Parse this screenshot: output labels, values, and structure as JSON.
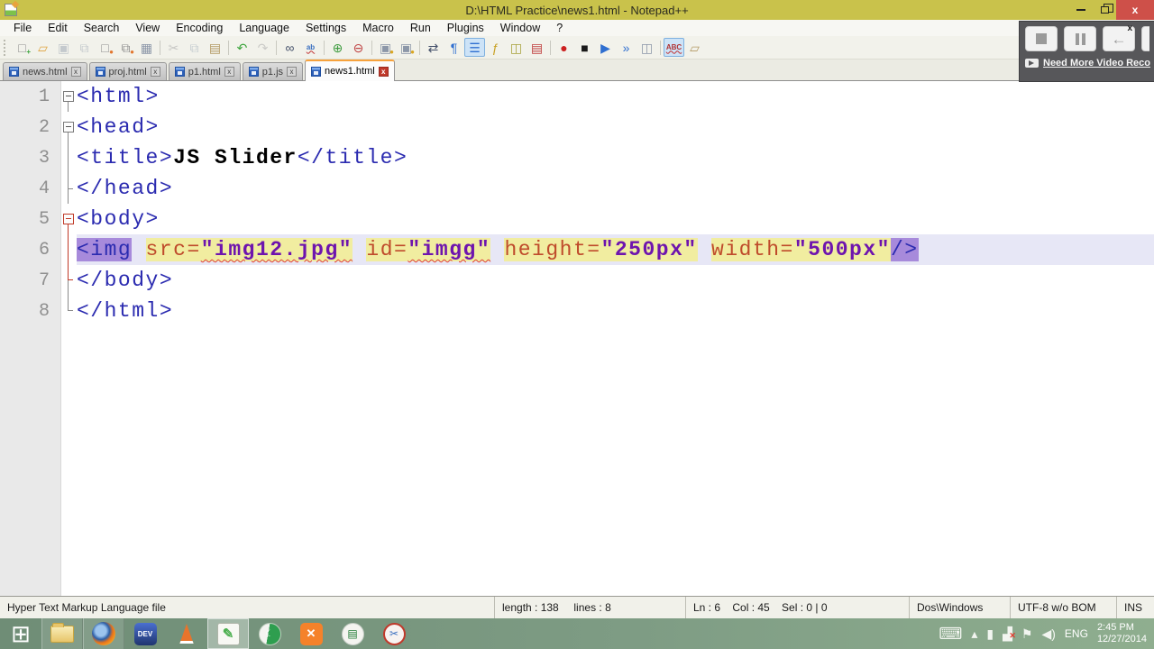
{
  "window": {
    "title": "D:\\HTML Practice\\news1.html - Notepad++",
    "controls": {
      "close": "x"
    }
  },
  "menu": {
    "items": [
      "File",
      "Edit",
      "Search",
      "View",
      "Encoding",
      "Language",
      "Settings",
      "Macro",
      "Run",
      "Plugins",
      "Window",
      "?"
    ]
  },
  "toolbar": {
    "items": [
      {
        "name": "new-file",
        "glyph": "□",
        "color": "#8f8f8f",
        "badge": "+",
        "badge_color": "#3BA43B"
      },
      {
        "name": "open-file",
        "glyph": "▱",
        "color": "#DFA43F"
      },
      {
        "name": "save-file",
        "glyph": "▣",
        "color": "#9FA9B5",
        "disabled": true
      },
      {
        "name": "save-all",
        "glyph": "⧉",
        "color": "#9FA9B5",
        "disabled": true
      },
      {
        "name": "close-file",
        "glyph": "□",
        "color": "#8f8f8f",
        "badge": "●",
        "badge_color": "#E2762F"
      },
      {
        "name": "close-all",
        "glyph": "⧉",
        "color": "#8f8f8f",
        "badge": "●",
        "badge_color": "#E2762F"
      },
      {
        "name": "print",
        "glyph": "▦",
        "color": "#8C97A8"
      },
      {
        "sep": true
      },
      {
        "name": "cut",
        "glyph": "✂",
        "color": "#A3A3A3",
        "disabled": true
      },
      {
        "name": "copy",
        "glyph": "⧉",
        "color": "#A3AFBB",
        "disabled": true
      },
      {
        "name": "paste",
        "glyph": "▤",
        "color": "#B39A64"
      },
      {
        "sep": true
      },
      {
        "name": "undo",
        "glyph": "↶",
        "color": "#3BA43B"
      },
      {
        "name": "redo",
        "glyph": "↷",
        "color": "#ABABAB",
        "disabled": true
      },
      {
        "sep": true
      },
      {
        "name": "find",
        "glyph": "∞",
        "color": "#44506A"
      },
      {
        "name": "replace",
        "glyph": "ab",
        "color": "#3A6FC0",
        "text": true
      },
      {
        "sep": true
      },
      {
        "name": "zoom-in",
        "glyph": "⊕",
        "color": "#3F9C3F"
      },
      {
        "name": "zoom-out",
        "glyph": "⊖",
        "color": "#C04545"
      },
      {
        "sep": true
      },
      {
        "name": "sync-scroll-v",
        "glyph": "▣",
        "color": "#8C97A8",
        "badge": "●",
        "badge_color": "#D9A520"
      },
      {
        "name": "sync-scroll-h",
        "glyph": "▣",
        "color": "#8C97A8",
        "badge": "●",
        "badge_color": "#D9A520"
      },
      {
        "sep": true
      },
      {
        "name": "word-wrap",
        "glyph": "⇄",
        "color": "#44506A"
      },
      {
        "name": "show-all-characters",
        "glyph": "¶",
        "color": "#2F6FD0"
      },
      {
        "name": "indent-guide",
        "glyph": "☰",
        "color": "#2F6FD0",
        "pressed": true
      },
      {
        "name": "function-list",
        "glyph": "ƒ",
        "color": "#C9A227"
      },
      {
        "name": "document-map",
        "glyph": "◫",
        "color": "#A8A23C"
      },
      {
        "name": "document-switcher",
        "glyph": "▤",
        "color": "#C04040"
      },
      {
        "sep": true
      },
      {
        "name": "macro-record",
        "glyph": "●",
        "color": "#CC2020"
      },
      {
        "name": "macro-stop",
        "glyph": "■",
        "color": "#1A1A1A"
      },
      {
        "name": "macro-play",
        "glyph": "▶",
        "color": "#2F6FD0"
      },
      {
        "name": "macro-run-multiple",
        "glyph": "»",
        "color": "#2F6FD0"
      },
      {
        "name": "macro-save",
        "glyph": "◫",
        "color": "#8C97A8"
      },
      {
        "sep": true
      },
      {
        "name": "spell-check",
        "glyph": "ABC",
        "color": "#B03030",
        "text": true,
        "pressed": true
      },
      {
        "name": "spell-check-settings",
        "glyph": "▱",
        "color": "#B39A64"
      }
    ]
  },
  "tabs": {
    "close_glyph": "x",
    "items": [
      {
        "label": "news.html",
        "active": false
      },
      {
        "label": "proj.html",
        "active": false
      },
      {
        "label": "p1.html",
        "active": false
      },
      {
        "label": "p1.js",
        "active": false
      },
      {
        "label": "news1.html",
        "active": true
      }
    ]
  },
  "editor": {
    "lines": [
      {
        "num": 1,
        "fold": [
          "box",
          "vb"
        ],
        "segments": [
          {
            "t": "<html>",
            "cls": "c-tag"
          }
        ]
      },
      {
        "num": 2,
        "fold": [
          "box",
          "vb"
        ],
        "segments": [
          {
            "t": "<head>",
            "cls": "c-tag"
          }
        ]
      },
      {
        "num": 3,
        "fold": [
          "v"
        ],
        "segments": [
          {
            "t": "<title>",
            "cls": "c-tag"
          },
          {
            "t": "JS Slider",
            "cls": "c-txt"
          },
          {
            "t": "</title>",
            "cls": "c-tag"
          }
        ]
      },
      {
        "num": 4,
        "fold": [
          "v",
          "stub"
        ],
        "segments": [
          {
            "t": "</head>",
            "cls": "c-tag"
          }
        ]
      },
      {
        "num": 5,
        "fold": [
          "box r",
          "vb r"
        ],
        "segments": [
          {
            "t": "<body>",
            "cls": "c-tag"
          }
        ]
      },
      {
        "num": 6,
        "fold": [
          "v r"
        ],
        "current": true,
        "segments": [
          {
            "t": "<img",
            "cls": "c-tag bg-match"
          },
          {
            "t": " ",
            "cls": ""
          },
          {
            "t": "src=",
            "cls": "c-attr bg-attr"
          },
          {
            "t": "\"img12.jpg\"",
            "cls": "c-val bg-attr sq"
          },
          {
            "t": " ",
            "cls": ""
          },
          {
            "t": "id=",
            "cls": "c-attr bg-attr"
          },
          {
            "t": "\"imgg\"",
            "cls": "c-val bg-attr sq"
          },
          {
            "t": " ",
            "cls": ""
          },
          {
            "t": "height=",
            "cls": "c-attr bg-attr"
          },
          {
            "t": "\"250px\"",
            "cls": "c-val bg-attr"
          },
          {
            "t": " ",
            "cls": ""
          },
          {
            "t": "width=",
            "cls": "c-attr bg-attr"
          },
          {
            "t": "\"500px\"",
            "cls": "c-val bg-attr"
          },
          {
            "t": "/>",
            "cls": "c-tag bg-match"
          }
        ]
      },
      {
        "num": 7,
        "fold": [
          "end r",
          "vbl"
        ],
        "segments": [
          {
            "t": "</body>",
            "cls": "c-tag"
          }
        ]
      },
      {
        "num": 8,
        "fold": [
          "end"
        ],
        "segments": [
          {
            "t": "</html>",
            "cls": "c-tag"
          }
        ]
      }
    ]
  },
  "statusbar": {
    "doctype": "Hyper Text Markup Language file",
    "length_lines": "length : 138     lines : 8",
    "position": "Ln : 6    Col : 45    Sel : 0 | 0",
    "eol": "Dos\\Windows",
    "encoding": "UTF-8 w/o BOM",
    "mode": "INS"
  },
  "recorder": {
    "buttons": [
      {
        "name": "stop-recording-button",
        "kind": "stop"
      },
      {
        "name": "pause-recording-button",
        "kind": "pause"
      },
      {
        "name": "back-button",
        "kind": "back",
        "glyph": "←"
      }
    ],
    "close_glyph": "x",
    "link": "Need More Video Recor"
  },
  "taskbar": {
    "apps": [
      {
        "name": "start-button",
        "style": "start",
        "glyph": "⊞"
      },
      {
        "name": "taskbar-file-explorer",
        "style": "explorer",
        "open": true
      },
      {
        "name": "taskbar-firefox",
        "style": "firefox",
        "open": true
      },
      {
        "name": "taskbar-dev-cpp",
        "style": "devcpp",
        "glyph": "DEV"
      },
      {
        "name": "taskbar-vlc",
        "style": "vlc"
      },
      {
        "name": "taskbar-notepad-plus-plus",
        "style": "npp",
        "glyph": "✎",
        "active": true
      },
      {
        "name": "taskbar-green-globe-app",
        "style": "greenball",
        "glyph": "☾"
      },
      {
        "name": "taskbar-xampp",
        "style": "xampp",
        "glyph": "✕"
      },
      {
        "name": "taskbar-quran-app",
        "style": "quran",
        "glyph": "▤"
      },
      {
        "name": "taskbar-snipping-tool",
        "style": "snip",
        "glyph": "✂"
      }
    ],
    "tray": {
      "icons": [
        {
          "name": "touch-keyboard-icon",
          "glyph": "⌨",
          "big": true
        },
        {
          "name": "show-hidden-icons",
          "glyph": "▴"
        },
        {
          "name": "power-icon",
          "glyph": "▮"
        },
        {
          "name": "network-icon",
          "glyph": "▟",
          "badge": "✕"
        },
        {
          "name": "action-center-flag-icon",
          "glyph": "⚑"
        },
        {
          "name": "volume-icon",
          "glyph": "◀)"
        }
      ],
      "lang": "ENG",
      "time": "2:45 PM",
      "date": "12/27/2014"
    }
  },
  "colors": {
    "titlebar": "#C9C24B",
    "close_button": "#CE5049",
    "active_tab_indicator": "#F7A23C",
    "current_line": "#E7E7F6",
    "tag_match_highlight": "#A78ADB",
    "attribute_highlight": "#F1EDA0",
    "taskbar": "#7E9C84"
  }
}
